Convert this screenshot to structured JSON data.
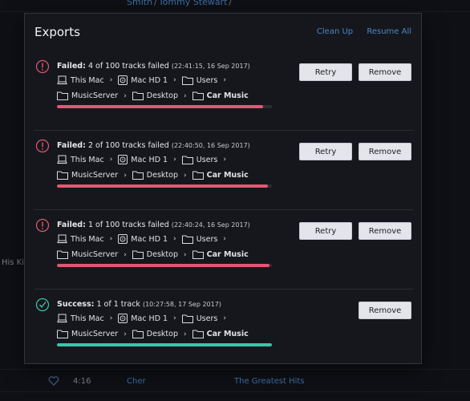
{
  "background": {
    "top_links": [
      "Smith",
      "Tommy Stewart",
      ""
    ],
    "top_sep": "/",
    "side_text": "His Kis",
    "bottom_row": {
      "duration": "4:16",
      "artist": "Cher",
      "album": "The Greatest Hits"
    }
  },
  "dialog": {
    "title": "Exports",
    "clean_up_label": "Clean Up",
    "resume_all_label": "Resume All"
  },
  "colors": {
    "failed": "#e05873",
    "success": "#38c6aa",
    "link": "#4a86c6"
  },
  "items": [
    {
      "status": "failed",
      "status_label": "Failed:",
      "detail": "4 of 100 tracks failed",
      "timestamp": "(22:41:15, 16 Sep 2017)",
      "path_line1": [
        "This Mac",
        "Mac HD 1",
        "Users"
      ],
      "path_line2": [
        "MusicServer",
        "Desktop",
        "Car Music"
      ],
      "progress": 0.96,
      "retry_label": "Retry",
      "remove_label": "Remove"
    },
    {
      "status": "failed",
      "status_label": "Failed:",
      "detail": "2 of 100 tracks failed",
      "timestamp": "(22:40:50, 16 Sep 2017)",
      "path_line1": [
        "This Mac",
        "Mac HD 1",
        "Users"
      ],
      "path_line2": [
        "MusicServer",
        "Desktop",
        "Car Music"
      ],
      "progress": 0.98,
      "retry_label": "Retry",
      "remove_label": "Remove"
    },
    {
      "status": "failed",
      "status_label": "Failed:",
      "detail": "1 of 100 tracks failed",
      "timestamp": "(22:40:24, 16 Sep 2017)",
      "path_line1": [
        "This Mac",
        "Mac HD 1",
        "Users"
      ],
      "path_line2": [
        "MusicServer",
        "Desktop",
        "Car Music"
      ],
      "progress": 0.99,
      "retry_label": "Retry",
      "remove_label": "Remove"
    },
    {
      "status": "success",
      "status_label": "Success:",
      "detail": "1 of 1 track",
      "timestamp": "(10:27:58, 17 Sep 2017)",
      "path_line1": [
        "This Mac",
        "Mac HD 1",
        "Users"
      ],
      "path_line2": [
        "MusicServer",
        "Desktop",
        "Car Music"
      ],
      "progress": 1.0,
      "remove_label": "Remove"
    }
  ]
}
